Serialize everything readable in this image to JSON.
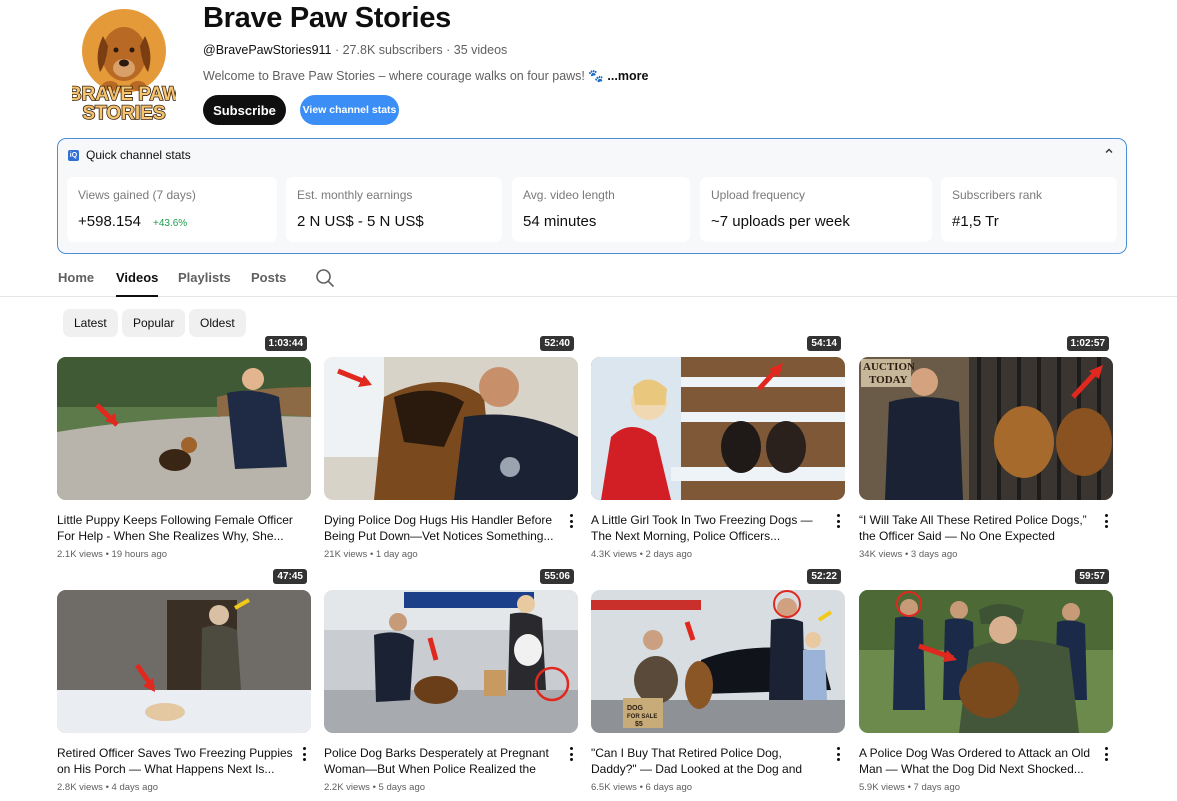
{
  "channel": {
    "name": "Brave Paw Stories",
    "handle": "@BravePawStories911",
    "subscribers": "27.8K subscribers",
    "videos_count": "35 videos",
    "description": "Welcome to Brave Paw Stories – where courage walks on four paws! 🐾",
    "more_label": "...more",
    "avatar_text_top": "BRAVE PAW",
    "avatar_text_bottom": "STORIES",
    "subscribe_label": "Subscribe",
    "stats_button_label": "View channel stats"
  },
  "quick_stats": {
    "title": "Quick channel stats",
    "icon_letter": "iQ",
    "collapse_icon": "chevron-up-icon",
    "cards": [
      {
        "label": "Views gained (7 days)",
        "value": "+598.154",
        "change": "+43.6%"
      },
      {
        "label": "Est. monthly earnings",
        "value": "2 N US$ - 5 N US$"
      },
      {
        "label": "Avg. video length",
        "value": "54 minutes"
      },
      {
        "label": "Upload frequency",
        "value": "~7 uploads per week"
      },
      {
        "label": "Subscribers rank",
        "value": "#1,5 Tr"
      }
    ]
  },
  "tabs": [
    {
      "label": "Home",
      "active": false
    },
    {
      "label": "Videos",
      "active": true
    },
    {
      "label": "Playlists",
      "active": false
    },
    {
      "label": "Posts",
      "active": false
    }
  ],
  "chips": [
    "Latest",
    "Popular",
    "Oldest"
  ],
  "videos": [
    {
      "title": "Little Puppy Keeps Following Female Officer For Help - When She Realizes Why, She...",
      "views": "2.1K views",
      "age": "19 hours ago",
      "duration": "1:03:44"
    },
    {
      "title": "Dying Police Dog Hugs His Handler Before Being Put Down—Vet Notices Something...",
      "views": "21K views",
      "age": "1 day ago",
      "duration": "52:40"
    },
    {
      "title": "A Little Girl Took In Two Freezing Dogs — The Next Morning, Police Officers...",
      "views": "4.3K views",
      "age": "2 days ago",
      "duration": "54:14"
    },
    {
      "title": "“I Will Take All These Retired Police Dogs,” the Officer Said — No One Expected What...",
      "views": "34K views",
      "age": "3 days ago",
      "duration": "1:02:57",
      "thumb_text": "AUCTION TODAY"
    },
    {
      "title": "Retired Officer Saves Two Freezing Puppies on His Porch — What Happens Next Is...",
      "views": "2.8K views",
      "age": "4 days ago",
      "duration": "47:45"
    },
    {
      "title": "Police Dog Barks Desperately at Pregnant Woman—But When Police Realized the Trut...",
      "views": "2.2K views",
      "age": "5 days ago",
      "duration": "55:06"
    },
    {
      "title": "\"Can I Buy That Retired Police Dog, Daddy?\" — Dad Looked at the Dog and Froze...",
      "views": "6.5K views",
      "age": "6 days ago",
      "duration": "52:22",
      "thumb_text": "DOG FOR SALE $5"
    },
    {
      "title": "A Police Dog Was Ordered to Attack an Old Man — What the Dog Did Next Shocked...",
      "views": "5.9K views",
      "age": "7 days ago",
      "duration": "59:57"
    }
  ]
}
